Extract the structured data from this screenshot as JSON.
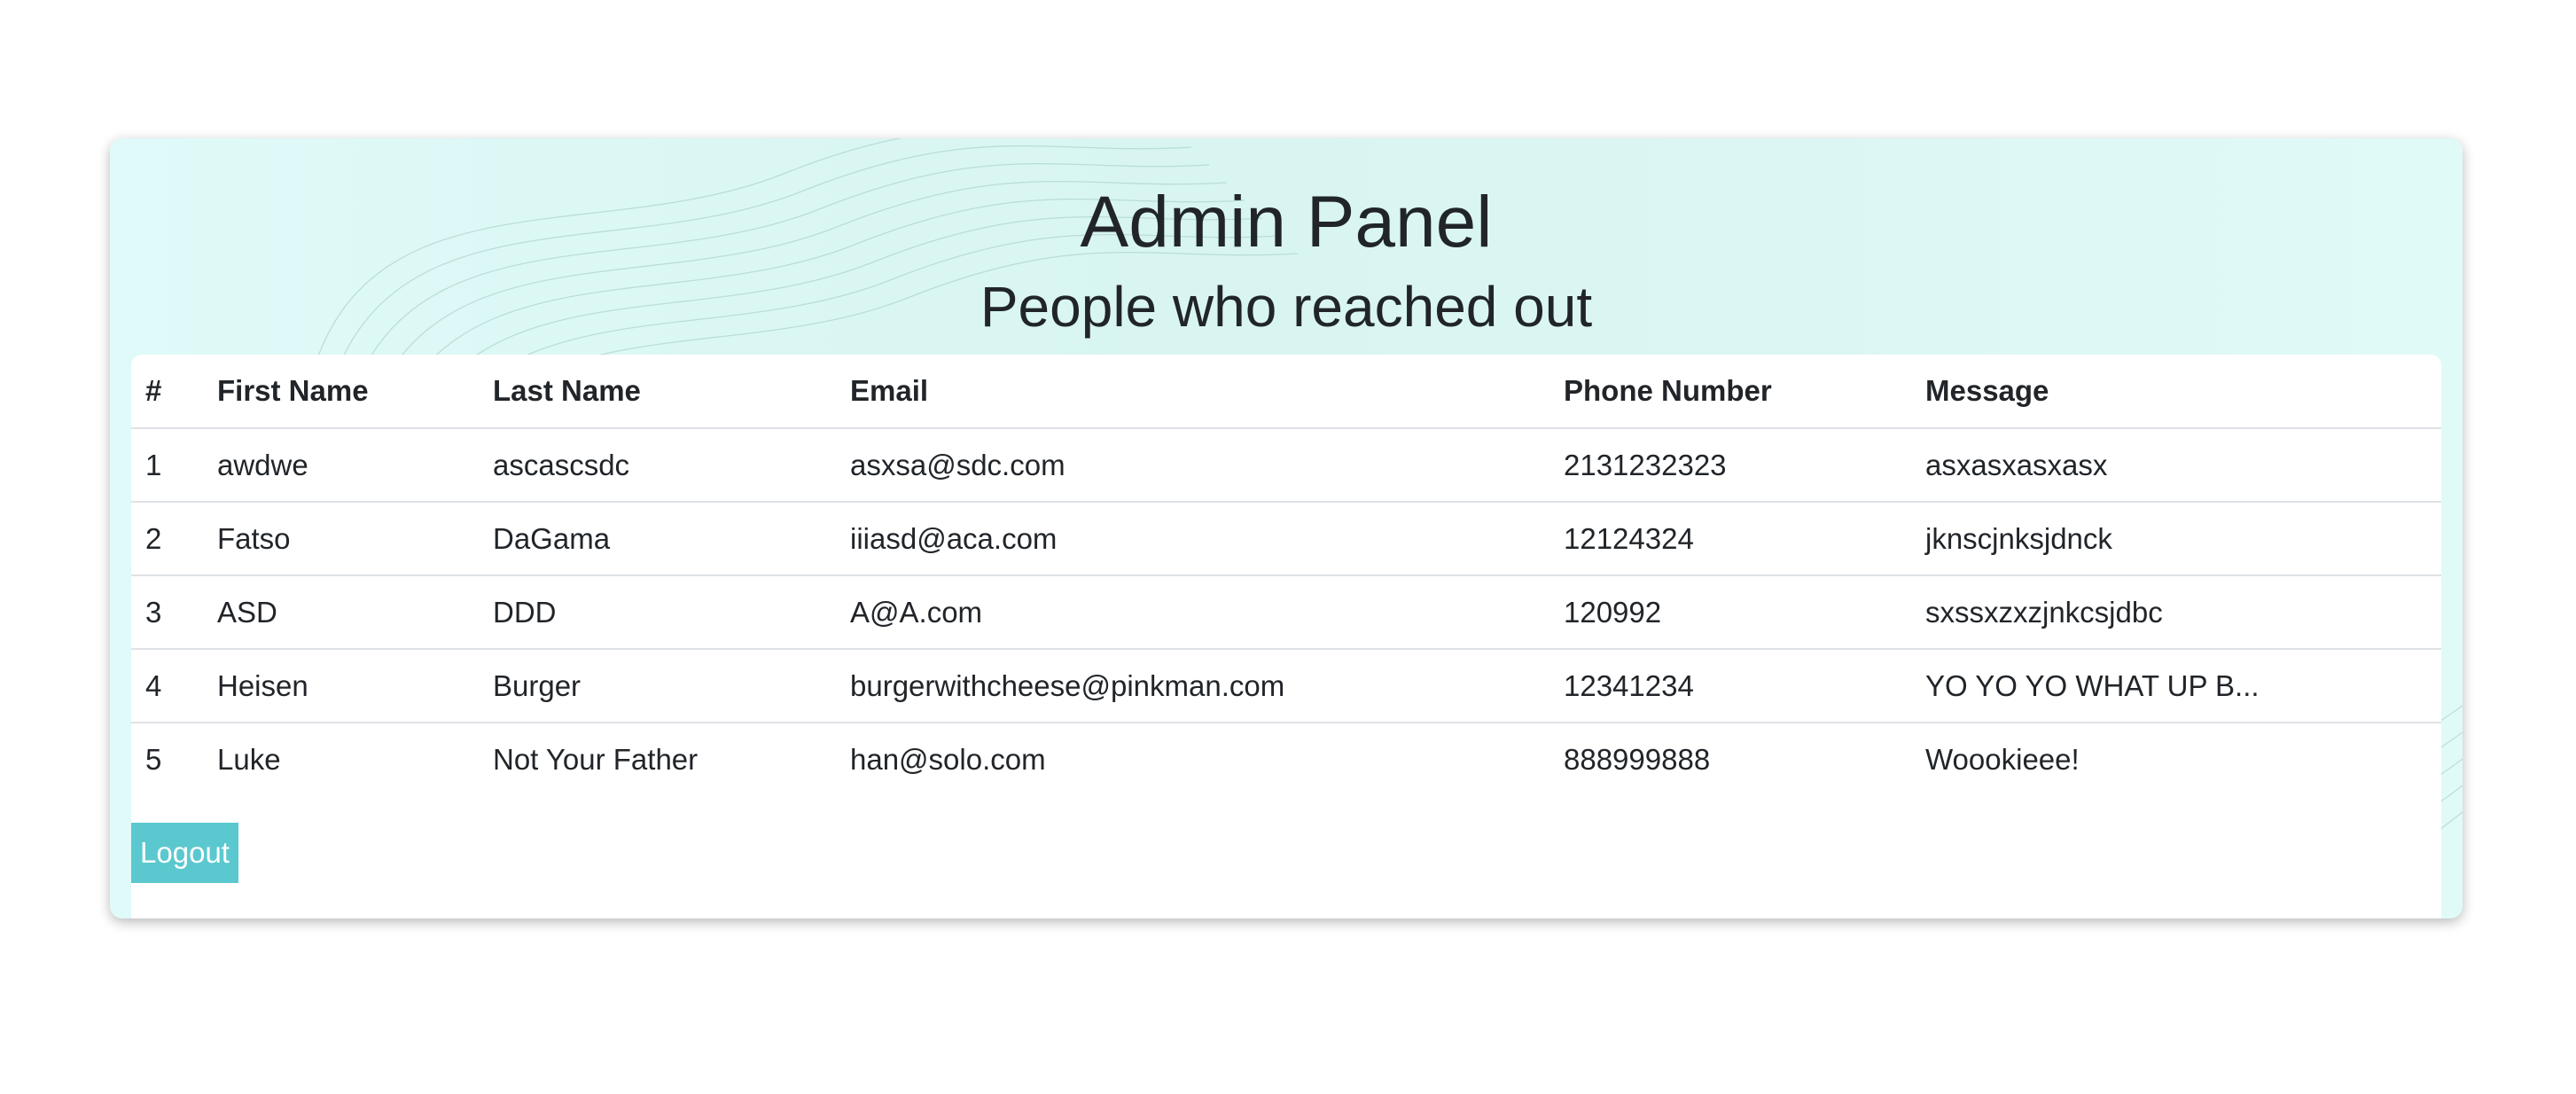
{
  "header": {
    "title": "Admin Panel",
    "subtitle": "People who reached out"
  },
  "table": {
    "columns": [
      "#",
      "First Name",
      "Last Name",
      "Email",
      "Phone Number",
      "Message"
    ],
    "rows": [
      [
        "1",
        "awdwe",
        "ascascsdc",
        "asxsa@sdc.com",
        "2131232323",
        "asxasxasxasx"
      ],
      [
        "2",
        "Fatso",
        "DaGama",
        "iiiasd@aca.com",
        "12124324",
        "jknscjnksjdnck"
      ],
      [
        "3",
        "ASD",
        "DDD",
        "A@A.com",
        "120992",
        "sxssxzxzjnkcsjdbc"
      ],
      [
        "4",
        "Heisen",
        "Burger",
        "burgerwithcheese@pinkman.com",
        "12341234",
        "YO YO YO WHAT UP B..."
      ],
      [
        "5",
        "Luke",
        "Not Your Father",
        "han@solo.com",
        "888999888",
        "Woookieee!"
      ]
    ]
  },
  "actions": {
    "logout_label": "Logout"
  },
  "colors": {
    "accent": "#5bc8cf",
    "panel_bg": "#dcf6f3",
    "text": "#212529"
  }
}
